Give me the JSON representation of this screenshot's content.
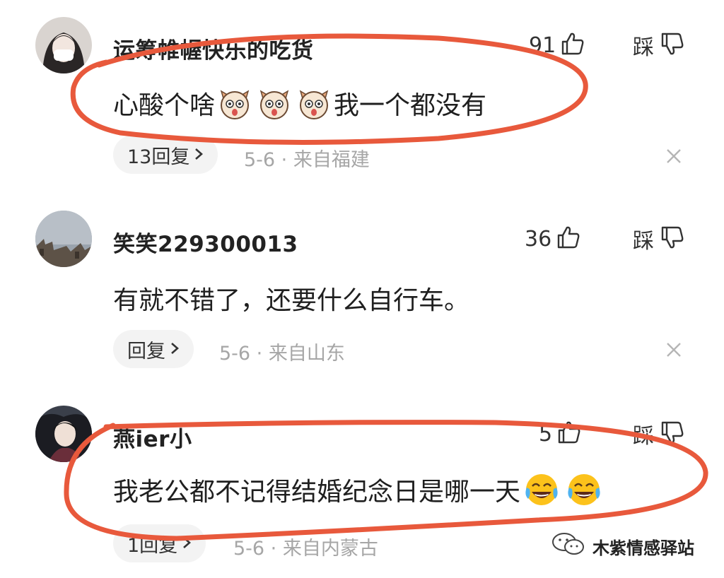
{
  "comments": [
    {
      "username": "运筹帷幄快乐的吃货",
      "likes": "91",
      "dislike_label": "踩",
      "text_before": "心酸个啥",
      "emoji": [
        "dog-emoji",
        "dog-emoji",
        "dog-emoji"
      ],
      "text_after": "我一个都没有",
      "reply_label": "13回复",
      "meta": "5-6 · 来自福建"
    },
    {
      "username": "笑笑229300013",
      "likes": "36",
      "dislike_label": "踩",
      "text_before": "有就不错了，还要什么自行车。",
      "emoji": [],
      "text_after": "",
      "reply_label": "回复",
      "meta": "5-6 · 来自山东"
    },
    {
      "username": "燕ier小",
      "likes": "5",
      "dislike_label": "踩",
      "text_before": "我老公都不记得结婚纪念日是哪一天",
      "emoji": [
        "tears-of-joy-emoji",
        "tears-of-joy-emoji"
      ],
      "text_after": "",
      "reply_label": "1回复",
      "meta": "5-6 · 来自内蒙古"
    }
  ],
  "watermark": {
    "text": "木紫情感驿站"
  },
  "colors": {
    "annotation": "#e8593c",
    "meta": "#a6a6a6",
    "pill": "#f3f3f3"
  }
}
